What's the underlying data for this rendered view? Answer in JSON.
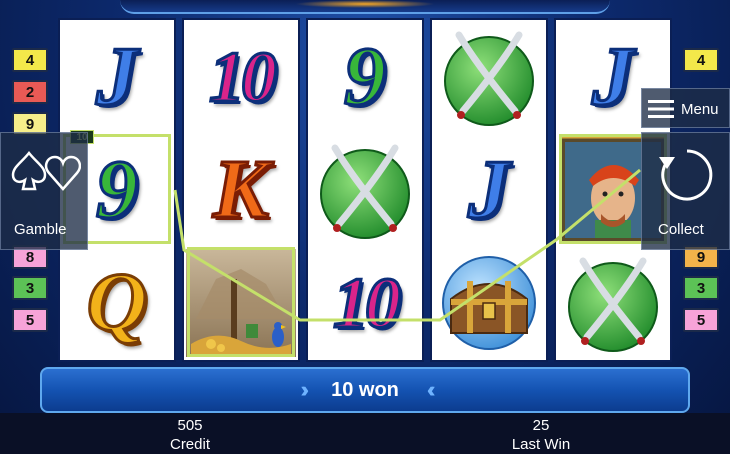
{
  "reels": [
    [
      {
        "symbol": "J",
        "color": "blue"
      },
      {
        "symbol": "9",
        "color": "green"
      },
      {
        "symbol": "Q",
        "color": "gold"
      }
    ],
    [
      {
        "symbol": "10",
        "color": "pink"
      },
      {
        "symbol": "K",
        "color": "orange"
      },
      {
        "symbol": "treasure-map",
        "color": ""
      }
    ],
    [
      {
        "symbol": "9",
        "color": "green"
      },
      {
        "symbol": "crossed-sabres",
        "color": ""
      },
      {
        "symbol": "10",
        "color": "pink"
      }
    ],
    [
      {
        "symbol": "crossed-sabres",
        "color": ""
      },
      {
        "symbol": "J",
        "color": "blue"
      },
      {
        "symbol": "treasure-chest",
        "color": ""
      }
    ],
    [
      {
        "symbol": "J",
        "color": "blue"
      },
      {
        "symbol": "pirate-captain",
        "color": ""
      },
      {
        "symbol": "crossed-sabres",
        "color": ""
      }
    ]
  ],
  "line_badge": "10",
  "left_lines": [
    "4",
    "2",
    "9",
    "",
    "",
    "",
    "8",
    "3",
    "5"
  ],
  "right_lines": [
    "4",
    "",
    "",
    "",
    "",
    "",
    "9",
    "3",
    "5"
  ],
  "gamble": {
    "label": "Gamble",
    "icon": "card-suits-icon"
  },
  "menu": {
    "label": "Menu",
    "icon": "hamburger-icon"
  },
  "collect": {
    "label": "Collect",
    "icon": "refresh-icon"
  },
  "win_message": "10 won",
  "credit": {
    "value": "505",
    "label": "Credit"
  },
  "last_win": {
    "value": "25",
    "label": "Last Win"
  },
  "colors": {
    "win_line": "#c4e06a",
    "background": "#0d2a6e",
    "status_bar": "#0a1026"
  }
}
